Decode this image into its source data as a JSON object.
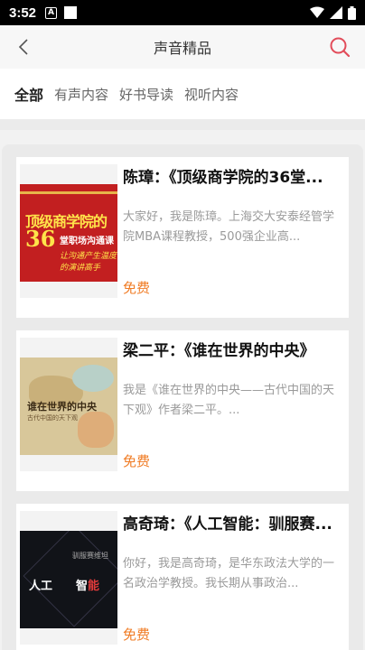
{
  "statusbar": {
    "time": "3:52",
    "a_icon_label": "A"
  },
  "header": {
    "title": "声音精品"
  },
  "tabs": [
    {
      "label": "全部",
      "active": true
    },
    {
      "label": "有声内容",
      "active": false
    },
    {
      "label": "好书导读",
      "active": false
    },
    {
      "label": "视听内容",
      "active": false
    }
  ],
  "items": [
    {
      "title": "陈璋：《顶级商学院的36堂...",
      "desc": "大家好，我是陈璋。上海交大安泰经管学院MBA课程教授，500强企业高...",
      "price": "免费",
      "cover": {
        "line1": "顶级商学院的",
        "num": "36",
        "line2": "堂职场沟通课",
        "line3": "让沟通产生温度的演讲高手"
      }
    },
    {
      "title": "梁二平：《谁在世界的中央》",
      "desc": "我是《谁在世界的中央——古代中国的天下观》作者梁二平。...",
      "price": "免费",
      "cover": {
        "line1": "谁在世界的中央",
        "line2": "古代中国的天下观"
      }
    },
    {
      "title": "高奇琦：《人工智能：驯服赛...",
      "desc": "你好，我是高奇琦，是华东政法大学的一名政治学教授。我长期从事政治...",
      "price": "免费",
      "cover": {
        "line1": "人工",
        "line2": "智",
        "line2b": "能",
        "sub": "驯服赛维坦"
      }
    }
  ],
  "colors": {
    "accent": "#f07c25",
    "search_icon": "#e24c5a"
  }
}
